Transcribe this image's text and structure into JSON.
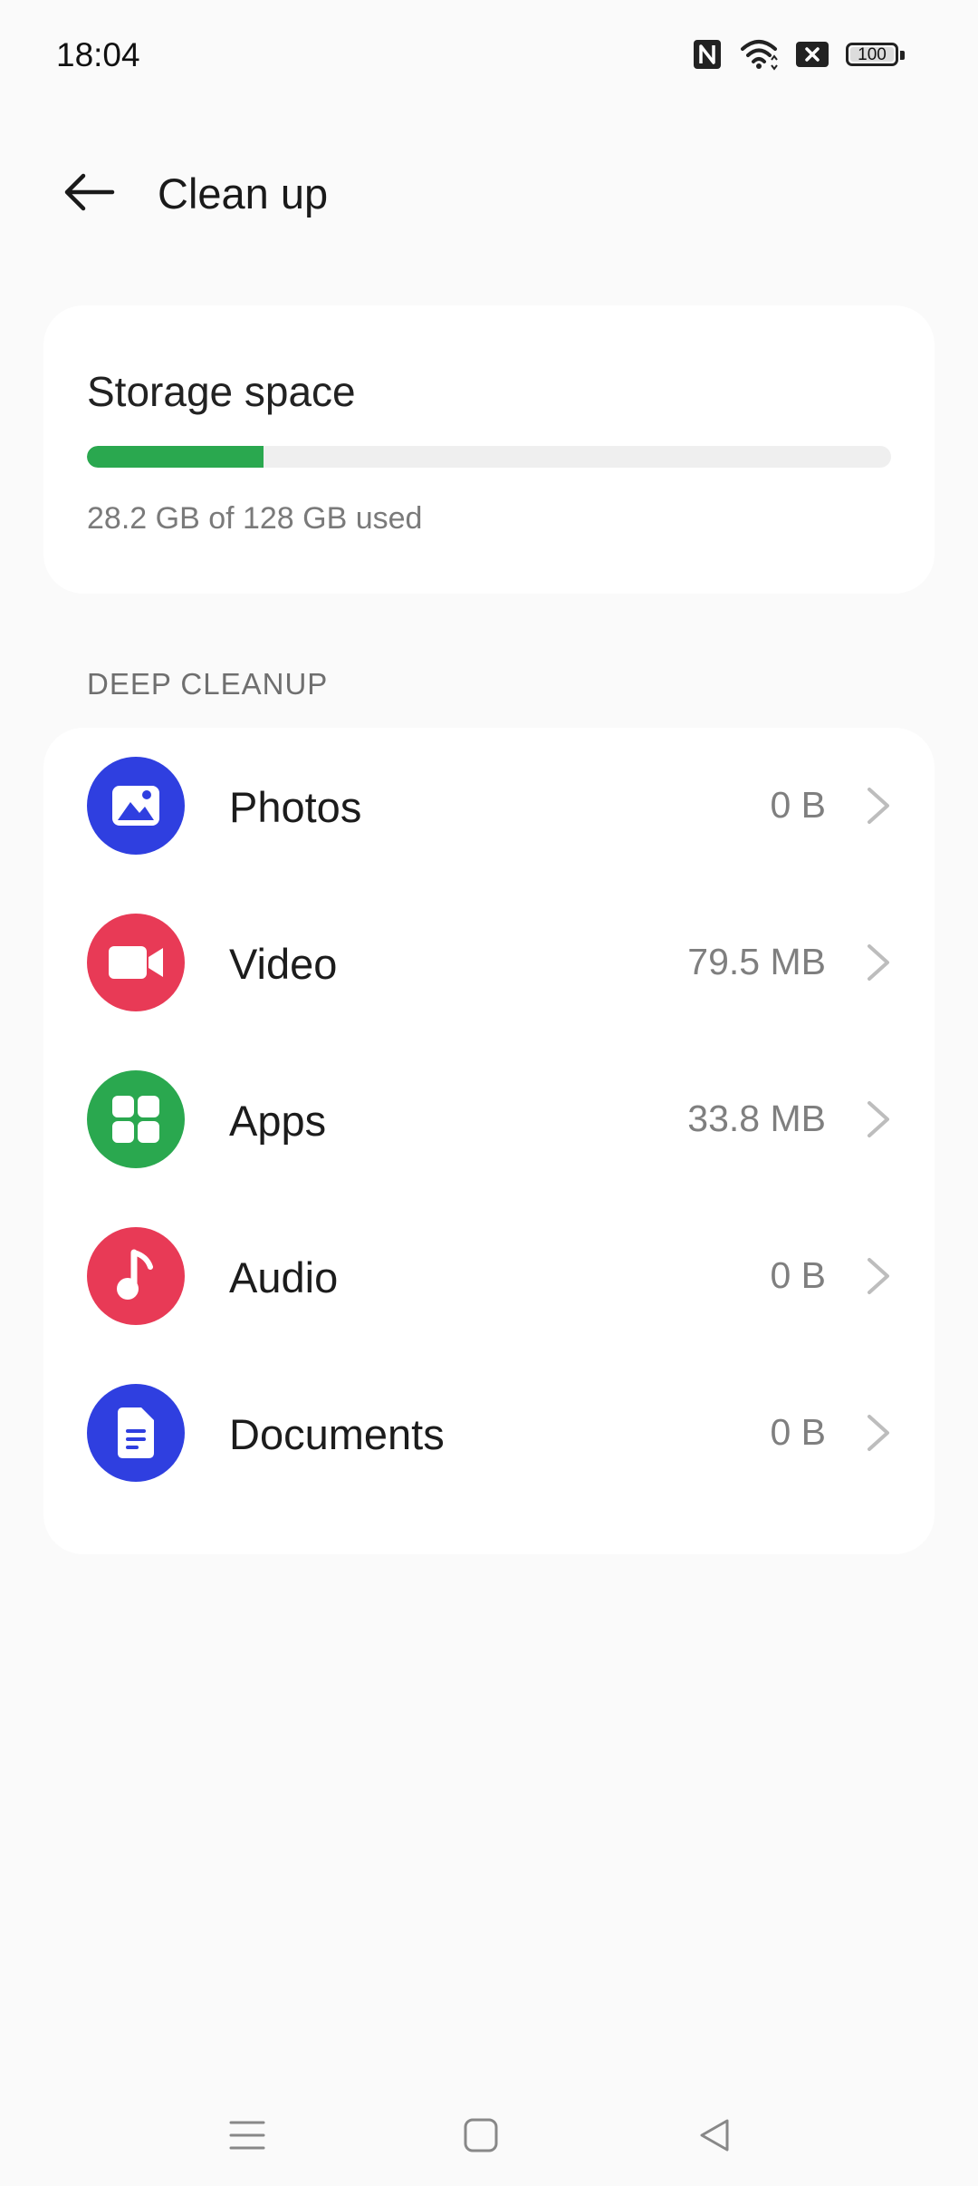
{
  "status_bar": {
    "time": "18:04",
    "battery_level": "100",
    "icons": [
      "nfc-icon",
      "wifi-icon",
      "sim-off-icon",
      "battery-icon"
    ]
  },
  "header": {
    "title": "Clean up",
    "back_icon": "arrow-left-icon"
  },
  "storage": {
    "title": "Storage space",
    "used_text": "28.2 GB of 128 GB used",
    "used_fraction": 0.22,
    "bar_color": "#2aa84f"
  },
  "deep_cleanup": {
    "section_label": "DEEP CLEANUP",
    "items": [
      {
        "label": "Photos",
        "value": "0 B",
        "icon": "image-icon",
        "color": "#2f3fe0"
      },
      {
        "label": "Video",
        "value": "79.5 MB",
        "icon": "video-camera-icon",
        "color": "#e83a56"
      },
      {
        "label": "Apps",
        "value": "33.8 MB",
        "icon": "apps-grid-icon",
        "color": "#2aa84f"
      },
      {
        "label": "Audio",
        "value": "0 B",
        "icon": "music-note-icon",
        "color": "#e83a56"
      },
      {
        "label": "Documents",
        "value": "0 B",
        "icon": "document-icon",
        "color": "#2f3fe0"
      }
    ]
  },
  "nav_bar": {
    "buttons": [
      "menu-icon",
      "home-icon",
      "back-triangle-icon"
    ]
  }
}
